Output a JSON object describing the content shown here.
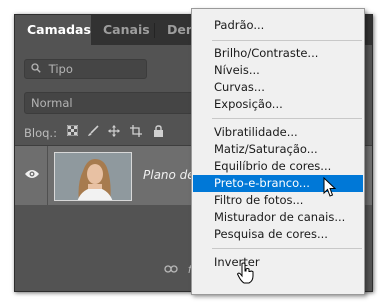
{
  "tabs": [
    {
      "label": "Camadas",
      "active": true
    },
    {
      "label": "Canais",
      "active": false
    },
    {
      "label": "Demarc",
      "active": false
    }
  ],
  "search": {
    "placeholder": "Tipo",
    "icon": "search-icon"
  },
  "blend_mode": "Normal",
  "lock": {
    "label": "Bloq.:",
    "icons": [
      "checkerboard-icon",
      "brush-icon",
      "move-icon",
      "crop-icon",
      "lock-icon"
    ]
  },
  "layer": {
    "name": "Plano de",
    "visible": true
  },
  "bottom_icons": [
    "link-icon",
    "fx-icon",
    "mask-icon",
    "adjustment-icon",
    "folder-icon",
    "new-layer-icon",
    "trash-icon"
  ],
  "menu": {
    "groups": [
      [
        "Padrão..."
      ],
      [
        "Brilho/Contraste...",
        "Níveis...",
        "Curvas...",
        "Exposição..."
      ],
      [
        "Vibratilidade...",
        "Matiz/Saturação...",
        "Equilíbrio de cores...",
        "Preto-e-branco...",
        "Filtro de fotos...",
        "Misturador de canais...",
        "Pesquisa de cores..."
      ],
      [
        "Inverter"
      ]
    ],
    "highlighted": "Preto-e-branco...",
    "highlight_color": "#0078d7"
  }
}
